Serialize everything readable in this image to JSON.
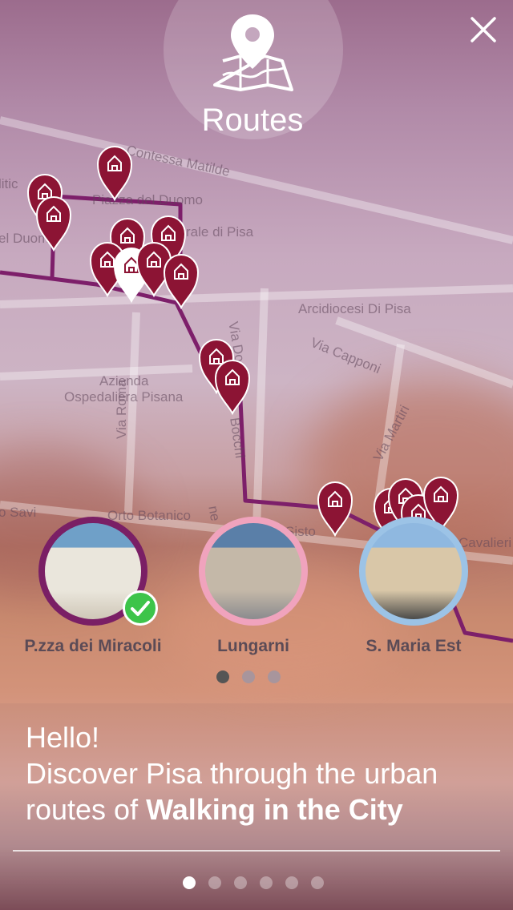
{
  "header": {
    "title": "Routes",
    "icon": "map-pin-icon",
    "close_icon": "close-icon"
  },
  "map": {
    "labels": [
      {
        "text": "Contessa Matilde"
      },
      {
        "text": "Piazza del Duomo"
      },
      {
        "text": "litic"
      },
      {
        "text": "el Duom"
      },
      {
        "text": "rale di Pisa"
      },
      {
        "text": "Arcidiocesi Di Pisa"
      },
      {
        "text": "Via Capponi"
      },
      {
        "text": "Via Do"
      },
      {
        "text": "Azienda"
      },
      {
        "text": "Ospedaliera Pisana"
      },
      {
        "text": "Via Roma"
      },
      {
        "text": "Via Martiri"
      },
      {
        "text": "Orto Botanico"
      },
      {
        "text": "o Savi"
      },
      {
        "text": "Sisto"
      },
      {
        "text": "Cavalieri"
      },
      {
        "text": "ne"
      },
      {
        "text": "Bocchi"
      }
    ],
    "route_color": "#7d1f6a",
    "pin_color": "#8c1434"
  },
  "routes": [
    {
      "label": "P.zza dei Miracoli",
      "ring_color": "#7a1f65",
      "selected": true
    },
    {
      "label": "Lungarni",
      "ring_color": "#f0a3bd",
      "selected": false
    },
    {
      "label": "S. Maria Est",
      "ring_color": "#9cc3e6",
      "selected": false
    }
  ],
  "routes_pager": {
    "count": 3,
    "active": 0
  },
  "intro": {
    "greeting": "Hello!",
    "line": "Discover Pisa through the urban routes of",
    "highlight": "Walking in the City"
  },
  "onboarding_pager": {
    "count": 6,
    "active": 0
  },
  "colors": {
    "check": "#3dc44a",
    "text_dark": "#5b4b56",
    "dot_active_routes": "#555555",
    "dot_inactive_routes": "#a8959c"
  }
}
